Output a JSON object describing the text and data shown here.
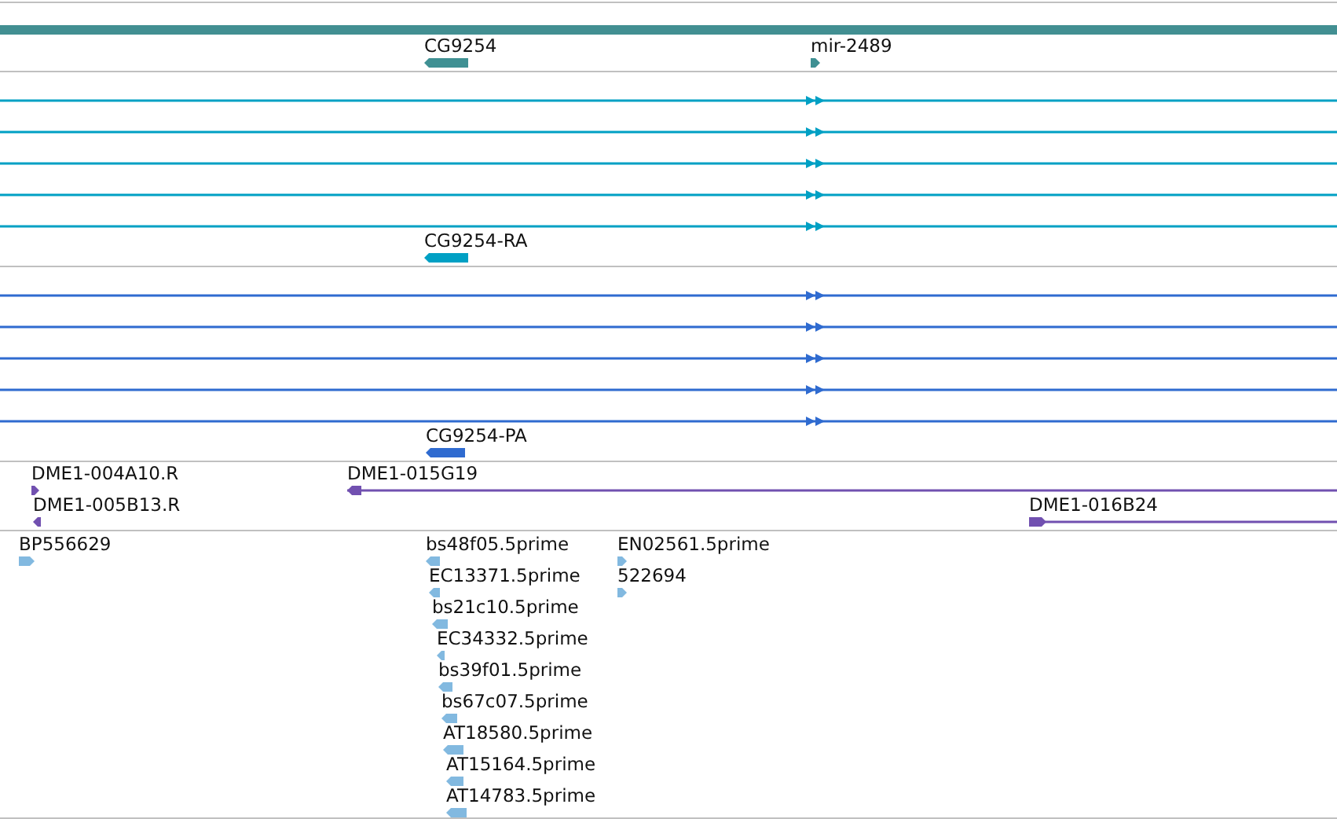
{
  "tracks": [
    {
      "color": "#3f9093",
      "features": [
        {
          "kind": "block",
          "label": "CG9254",
          "reverse": true
        },
        {
          "kind": "block",
          "label": "mir-2489",
          "reverse": false
        }
      ]
    },
    {
      "color": "#00a0c4",
      "features": [
        {
          "kind": "line",
          "reverse": false
        },
        {
          "kind": "line",
          "reverse": false
        },
        {
          "kind": "line",
          "reverse": false
        },
        {
          "kind": "line",
          "reverse": false
        },
        {
          "kind": "line",
          "reverse": false
        },
        {
          "kind": "block",
          "label": "CG9254-RA",
          "reverse": true
        }
      ]
    },
    {
      "color": "#2f6bd0",
      "features": [
        {
          "kind": "line",
          "reverse": false
        },
        {
          "kind": "line",
          "reverse": false
        },
        {
          "kind": "line",
          "reverse": false
        },
        {
          "kind": "line",
          "reverse": false
        },
        {
          "kind": "line",
          "reverse": false
        },
        {
          "kind": "block",
          "label": "CG9254-PA",
          "reverse": true
        }
      ]
    },
    {
      "color": "#7150b0",
      "features": [
        {
          "kind": "block",
          "label": "DME1-004A10.R",
          "reverse": false
        },
        {
          "kind": "span",
          "label": "DME1-015G19",
          "reverse": true
        },
        {
          "kind": "block",
          "label": "DME1-005B13.R",
          "reverse": true
        },
        {
          "kind": "span",
          "label": "DME1-016B24",
          "reverse": false
        }
      ]
    },
    {
      "color": "#82b9e0",
      "features": [
        {
          "kind": "block",
          "label": "BP556629",
          "reverse": false
        },
        {
          "kind": "block",
          "label": "bs48f05.5prime",
          "reverse": true
        },
        {
          "kind": "block",
          "label": "EN02561.5prime",
          "reverse": false
        },
        {
          "kind": "block",
          "label": "EC13371.5prime",
          "reverse": true
        },
        {
          "kind": "block",
          "label": "522694",
          "reverse": false
        },
        {
          "kind": "block",
          "label": "bs21c10.5prime",
          "reverse": true
        },
        {
          "kind": "block",
          "label": "EC34332.5prime",
          "reverse": true
        },
        {
          "kind": "block",
          "label": "bs39f01.5prime",
          "reverse": true
        },
        {
          "kind": "block",
          "label": "bs67c07.5prime",
          "reverse": true
        },
        {
          "kind": "block",
          "label": "AT18580.5prime",
          "reverse": true
        },
        {
          "kind": "block",
          "label": "AT15164.5prime",
          "reverse": true
        },
        {
          "kind": "block",
          "label": "AT14783.5prime",
          "reverse": true
        }
      ]
    }
  ]
}
